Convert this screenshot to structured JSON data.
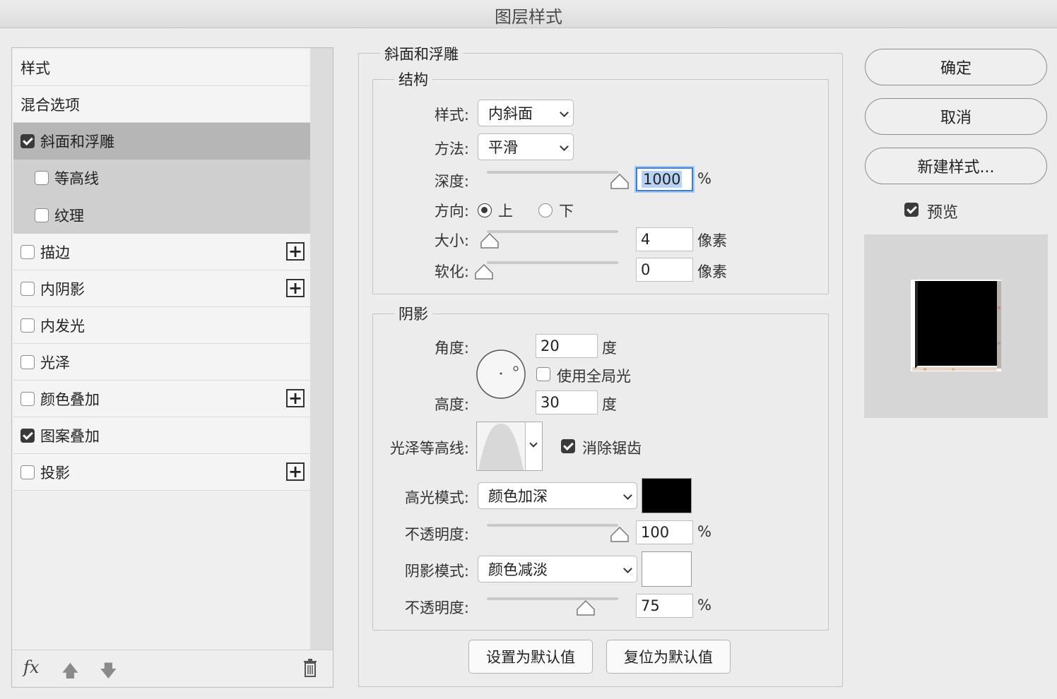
{
  "window": {
    "title": "图层样式"
  },
  "left_panel": {
    "header": "样式",
    "blend_options": "混合选项",
    "items": [
      {
        "label": "斜面和浮雕",
        "checked": true
      },
      {
        "label": "等高线",
        "checked": false
      },
      {
        "label": "纹理",
        "checked": false
      },
      {
        "label": "描边",
        "checked": false
      },
      {
        "label": "内阴影",
        "checked": false
      },
      {
        "label": "内发光",
        "checked": false
      },
      {
        "label": "光泽",
        "checked": false
      },
      {
        "label": "颜色叠加",
        "checked": false
      },
      {
        "label": "图案叠加",
        "checked": true
      },
      {
        "label": "投影",
        "checked": false
      }
    ],
    "fx_label": "fx"
  },
  "bevel": {
    "group_title": "斜面和浮雕",
    "structure": {
      "title": "结构",
      "style_label": "样式:",
      "style_value": "内斜面",
      "technique_label": "方法:",
      "technique_value": "平滑",
      "depth_label": "深度:",
      "depth_value": "1000",
      "depth_unit": "%",
      "direction_label": "方向:",
      "direction_up": "上",
      "direction_down": "下",
      "size_label": "大小:",
      "size_value": "4",
      "size_unit": "像素",
      "soften_label": "软化:",
      "soften_value": "0",
      "soften_unit": "像素"
    },
    "shading": {
      "title": "阴影",
      "angle_label": "角度:",
      "angle_value": "20",
      "angle_unit": "度",
      "global_light_label": "使用全局光",
      "altitude_label": "高度:",
      "altitude_value": "30",
      "altitude_unit": "度",
      "gloss_contour_label": "光泽等高线:",
      "anti_alias_label": "消除锯齿",
      "highlight_mode_label": "高光模式:",
      "highlight_mode_value": "颜色加深",
      "highlight_color": "#000000",
      "highlight_opacity_label": "不透明度:",
      "highlight_opacity_value": "100",
      "highlight_opacity_unit": "%",
      "shadow_mode_label": "阴影模式:",
      "shadow_mode_value": "颜色减淡",
      "shadow_color": "#ffffff",
      "shadow_opacity_label": "不透明度:",
      "shadow_opacity_value": "75",
      "shadow_opacity_unit": "%"
    },
    "make_default": "设置为默认值",
    "reset_default": "复位为默认值"
  },
  "right_panel": {
    "ok": "确定",
    "cancel": "取消",
    "new_style": "新建样式...",
    "preview_label": "预览"
  }
}
